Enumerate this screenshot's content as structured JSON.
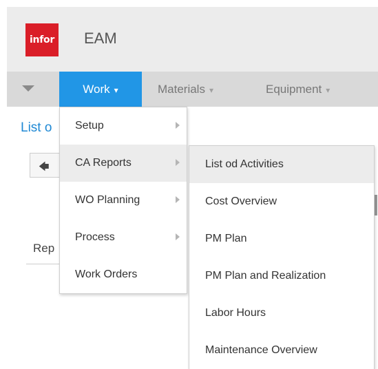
{
  "header": {
    "logo_text": "infor",
    "app_title": "EAM"
  },
  "nav": {
    "tabs": [
      {
        "label": "Work",
        "active": true
      },
      {
        "label": "Materials",
        "active": false
      },
      {
        "label": "Equipment",
        "active": false
      }
    ],
    "caret": "▾"
  },
  "page": {
    "title": "List o",
    "section_tab": "Rep"
  },
  "work_menu": {
    "items": [
      {
        "label": "Setup",
        "has_submenu": true
      },
      {
        "label": "CA Reports",
        "has_submenu": true,
        "highlighted": true
      },
      {
        "label": "WO Planning",
        "has_submenu": true
      },
      {
        "label": "Process",
        "has_submenu": true
      },
      {
        "label": "Work Orders",
        "has_submenu": false
      }
    ]
  },
  "ca_reports_submenu": {
    "items": [
      {
        "label": "List od Activities",
        "highlighted": true
      },
      {
        "label": "Cost Overview"
      },
      {
        "label": "PM Plan"
      },
      {
        "label": "PM Plan and Realization"
      },
      {
        "label": "Labor Hours"
      },
      {
        "label": "Maintenance Overview"
      }
    ]
  },
  "colors": {
    "accent": "#2196e6",
    "logo": "#da1e28",
    "title_link": "#1e88d4"
  }
}
